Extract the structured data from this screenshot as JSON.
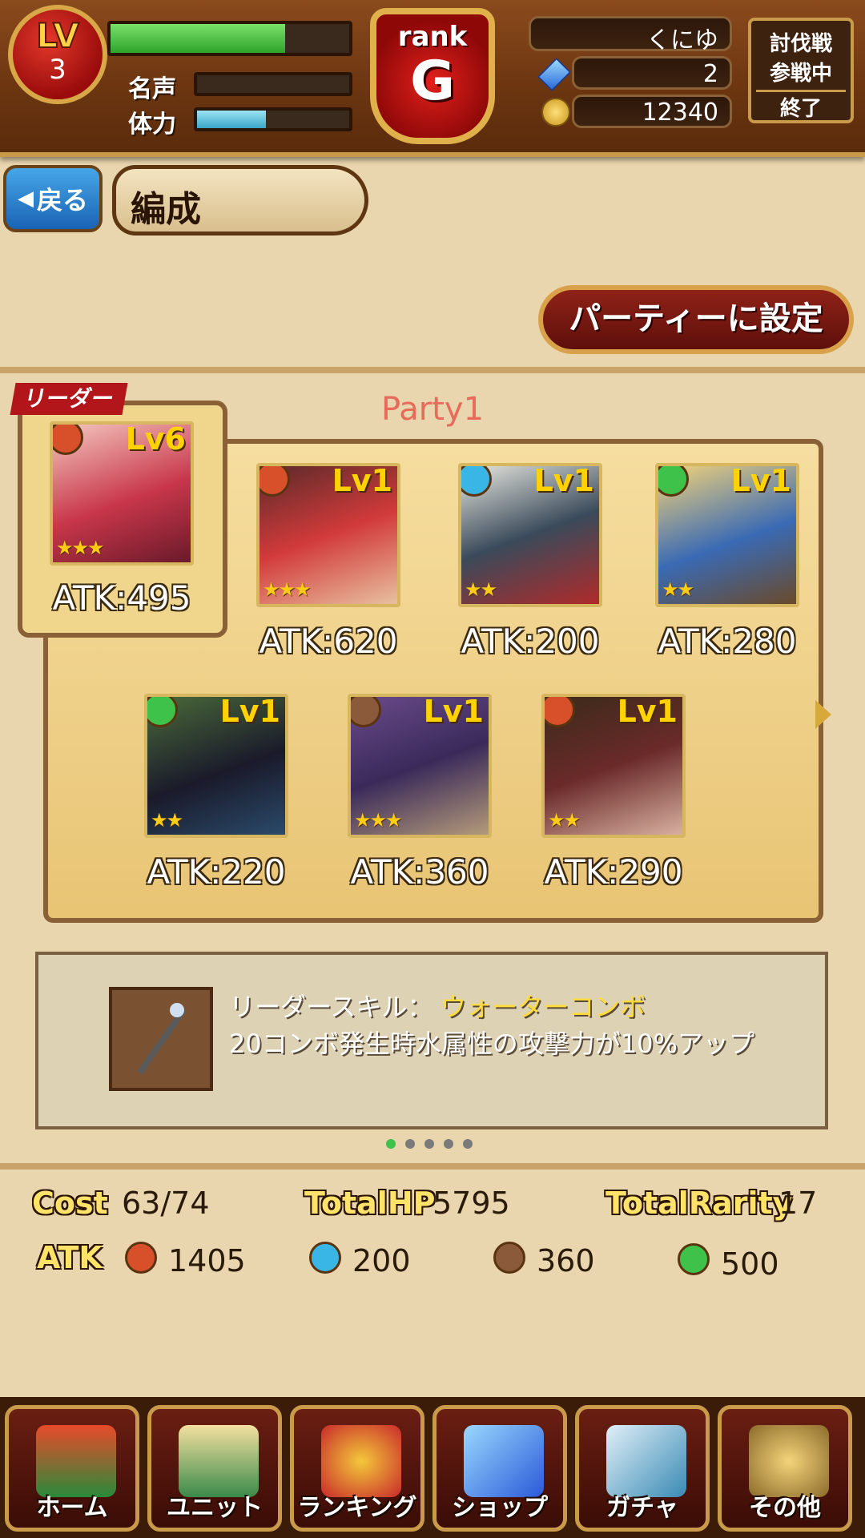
{
  "header": {
    "level_label": "LV",
    "level": "3",
    "fame_label": "名声",
    "stamina_label": "体力",
    "rank_label": "rank",
    "rank_letter": "G",
    "player_name": "くにゆ",
    "gems": "2",
    "coins": "12340",
    "battle_status_line1": "討伐戦",
    "battle_status_line2": "参戦中",
    "battle_status_end": "終了",
    "exp_progress": 0.73,
    "fame_progress": 0.0,
    "stamina_progress": 0.45
  },
  "subheader": {
    "back_label": "戻る",
    "title": "編成",
    "set_party_label": "パーティーに設定"
  },
  "party": {
    "name": "Party1",
    "leader_tag": "リーダー",
    "units": [
      {
        "level": "Lv6",
        "stars": "★★★",
        "atk": "ATK:495",
        "element": "fire"
      },
      {
        "level": "Lv1",
        "stars": "★★★",
        "atk": "ATK:620",
        "element": "fire"
      },
      {
        "level": "Lv1",
        "stars": "★★",
        "atk": "ATK:200",
        "element": "water"
      },
      {
        "level": "Lv1",
        "stars": "★★",
        "atk": "ATK:280",
        "element": "wind"
      },
      {
        "level": "Lv1",
        "stars": "★★",
        "atk": "ATK:220",
        "element": "wind"
      },
      {
        "level": "Lv1",
        "stars": "★★★",
        "atk": "ATK:360",
        "element": "dark"
      },
      {
        "level": "Lv1",
        "stars": "★★",
        "atk": "ATK:290",
        "element": "fire"
      }
    ]
  },
  "skill": {
    "label": "リーダースキル：",
    "name": "ウォーターコンボ",
    "description": "20コンボ発生時水属性の攻撃力が10%アップ"
  },
  "stats": {
    "cost_label": "Cost",
    "cost": "63/74",
    "total_hp_label": "TotalHP",
    "total_hp": "5795",
    "total_rarity_label": "TotalRarity",
    "total_rarity": "17",
    "atk_label": "ATK",
    "atk_fire": "1405",
    "atk_water": "200",
    "atk_dark": "360",
    "atk_wind": "500"
  },
  "nav": {
    "home": "ホーム",
    "unit": "ユニット",
    "ranking": "ランキング",
    "shop": "ショップ",
    "gacha": "ガチャ",
    "other": "その他"
  },
  "colors": {
    "fire": "#d8502a",
    "water": "#3ab6e6",
    "wind": "#3ec24a",
    "dark": "#8a5a3a"
  }
}
